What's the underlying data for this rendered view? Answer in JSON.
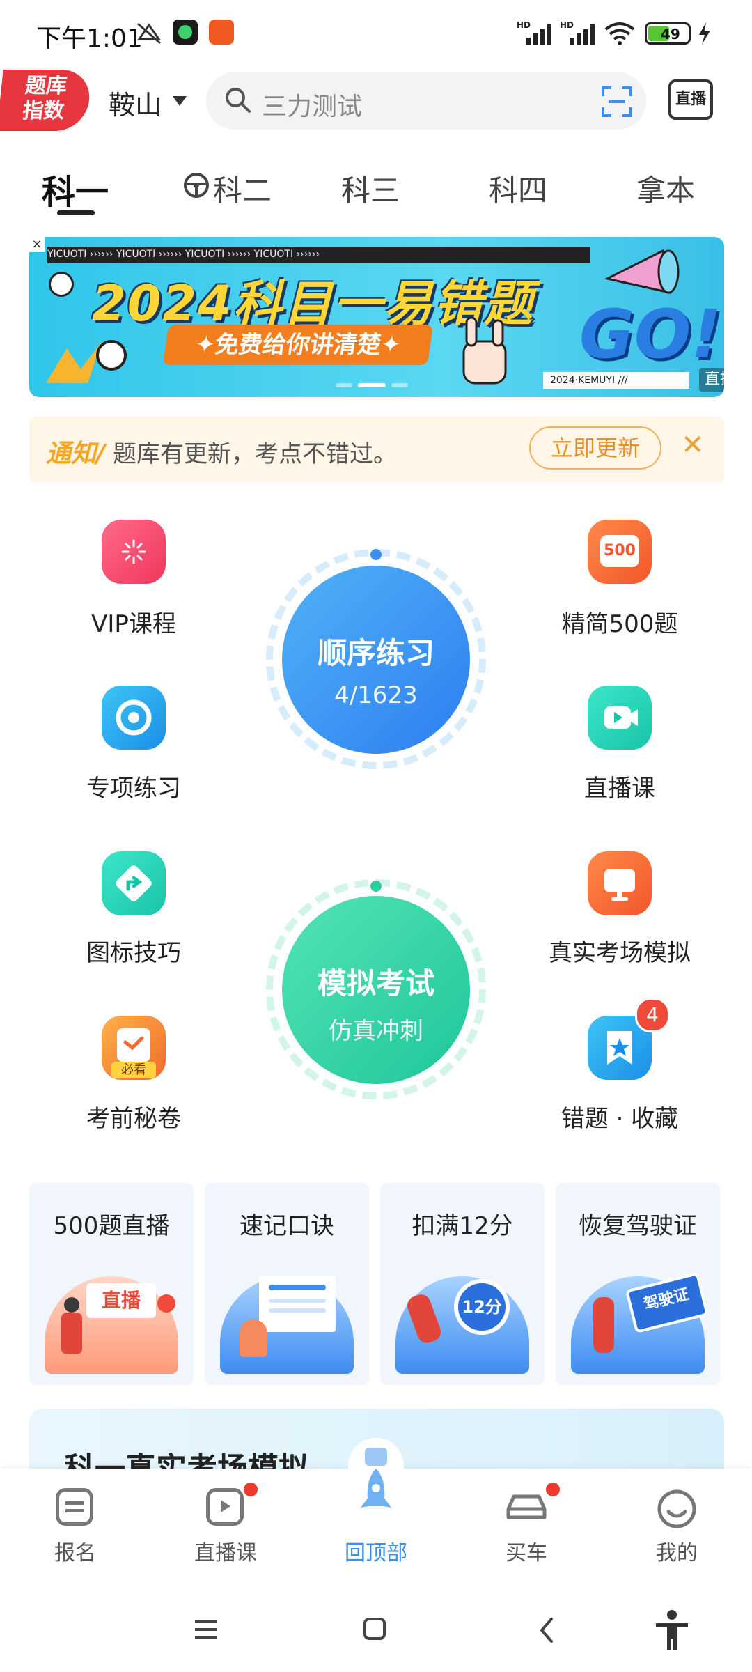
{
  "status_bar": {
    "time": "下午1:01",
    "battery": "49"
  },
  "header": {
    "logo_line1": "题库",
    "logo_line2": "指数",
    "city": "鞍山",
    "search_placeholder": "三力测试",
    "live_button": "直播"
  },
  "tabs": [
    {
      "label": "科一",
      "active": true
    },
    {
      "label": "科二",
      "active": false
    },
    {
      "label": "科三",
      "active": false
    },
    {
      "label": "科四",
      "active": false
    },
    {
      "label": "拿本",
      "active": false
    }
  ],
  "banner": {
    "strip_text": "YICUOTI ›››››› YICUOTI ›››››› YICUOTI ›››››› YICUOTI ››››››",
    "title": "2024科目一易错题",
    "subtitle": "✦免费给你讲清楚✦",
    "go": "GO!",
    "footer": "2024·KEMUYI ///",
    "tag": "直播"
  },
  "notice": {
    "tag": "通知/",
    "text": "题库有更新，考点不错过。",
    "button": "立即更新"
  },
  "features": {
    "vip": "VIP课程",
    "jingjian": "精简500题",
    "zhuanxiang": "专项练习",
    "zhibo": "直播课",
    "tubiao": "图标技巧",
    "zhenshi": "真实考场模拟",
    "kaoqian": "考前秘卷",
    "kaoqian_badge": "必看",
    "cuoti": "错题 · 收藏",
    "cuoti_count": "4",
    "jingjian_icon_text": "500"
  },
  "practice": {
    "title": "顺序练习",
    "progress": "4/1623"
  },
  "exam": {
    "title": "模拟考试",
    "subtitle": "仿真冲刺"
  },
  "cards": [
    {
      "title": "500题直播",
      "ill_text": "直播"
    },
    {
      "title": "速记口诀",
      "ill_text": ""
    },
    {
      "title": "扣满12分",
      "ill_text": "12分"
    },
    {
      "title": "恢复驾驶证",
      "ill_text": "驾驶证"
    }
  ],
  "bottom_section": {
    "title": "科一真实考场模拟"
  },
  "nav": [
    {
      "label": "报名",
      "active": false
    },
    {
      "label": "直播课",
      "active": false
    },
    {
      "label": "回顶部",
      "active": true
    },
    {
      "label": "买车",
      "active": false
    },
    {
      "label": "我的",
      "active": false
    }
  ],
  "colors": {
    "accent": "#3a8ef0",
    "practice": "#3d8cf0",
    "exam": "#2ccf9f",
    "notice_bg": "#fff6e8"
  }
}
